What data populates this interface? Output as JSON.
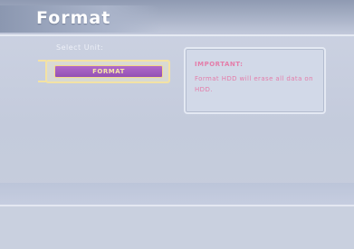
{
  "screen": {
    "title": "Format"
  },
  "menu": {
    "select_label": "Select Unit:",
    "format_button_label": "FORMAT"
  },
  "info": {
    "heading": "IMPORTANT:",
    "message": "Format HDD will erase all data on HDD."
  },
  "colors": {
    "accent_purple": "#9c58bc",
    "highlight_yellow": "#f3e2a4",
    "warning_pink": "#e47da9"
  }
}
